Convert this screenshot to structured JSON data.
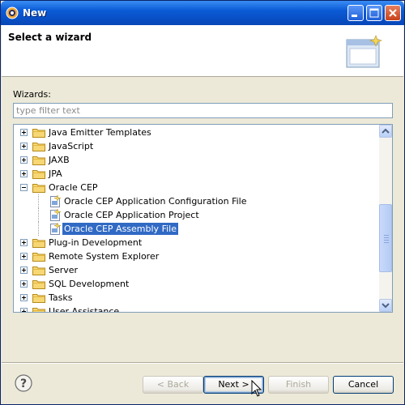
{
  "window": {
    "title": "New",
    "icon": "eclipse-icon",
    "controls": [
      "minimize",
      "maximize",
      "close"
    ]
  },
  "banner": {
    "title": "Select a wizard",
    "graphic": "new-wizard-window-icon"
  },
  "wizards_label": "Wizards:",
  "filter": {
    "value": "",
    "placeholder": "type filter text"
  },
  "tree": {
    "items": [
      {
        "label": "Java Emitter Templates",
        "type": "folder",
        "expanded": false,
        "level": 0
      },
      {
        "label": "JavaScript",
        "type": "folder",
        "expanded": false,
        "level": 0
      },
      {
        "label": "JAXB",
        "type": "folder",
        "expanded": false,
        "level": 0
      },
      {
        "label": "JPA",
        "type": "folder",
        "expanded": false,
        "level": 0
      },
      {
        "label": "Oracle CEP",
        "type": "folder",
        "expanded": true,
        "level": 0
      },
      {
        "label": "Oracle CEP Application Configuration File",
        "type": "file",
        "level": 1
      },
      {
        "label": "Oracle CEP Application Project",
        "type": "file",
        "level": 1
      },
      {
        "label": "Oracle CEP Assembly File",
        "type": "file",
        "level": 1,
        "selected": true
      },
      {
        "label": "Plug-in Development",
        "type": "folder",
        "expanded": false,
        "level": 0
      },
      {
        "label": "Remote System Explorer",
        "type": "folder",
        "expanded": false,
        "level": 0
      },
      {
        "label": "Server",
        "type": "folder",
        "expanded": false,
        "level": 0
      },
      {
        "label": "SQL Development",
        "type": "folder",
        "expanded": false,
        "level": 0
      },
      {
        "label": "Tasks",
        "type": "folder",
        "expanded": false,
        "level": 0
      },
      {
        "label": "User Assistance",
        "type": "folder",
        "expanded": false,
        "level": 0
      }
    ],
    "selection_color": "#316ac5"
  },
  "buttons": {
    "help": "help-icon",
    "back": "< Back",
    "next": "Next >",
    "finish": "Finish",
    "cancel": "Cancel"
  },
  "colors": {
    "titlebar": "#0a5bd6",
    "dialog_bg": "#ece9d8",
    "border": "#7f9db9"
  }
}
